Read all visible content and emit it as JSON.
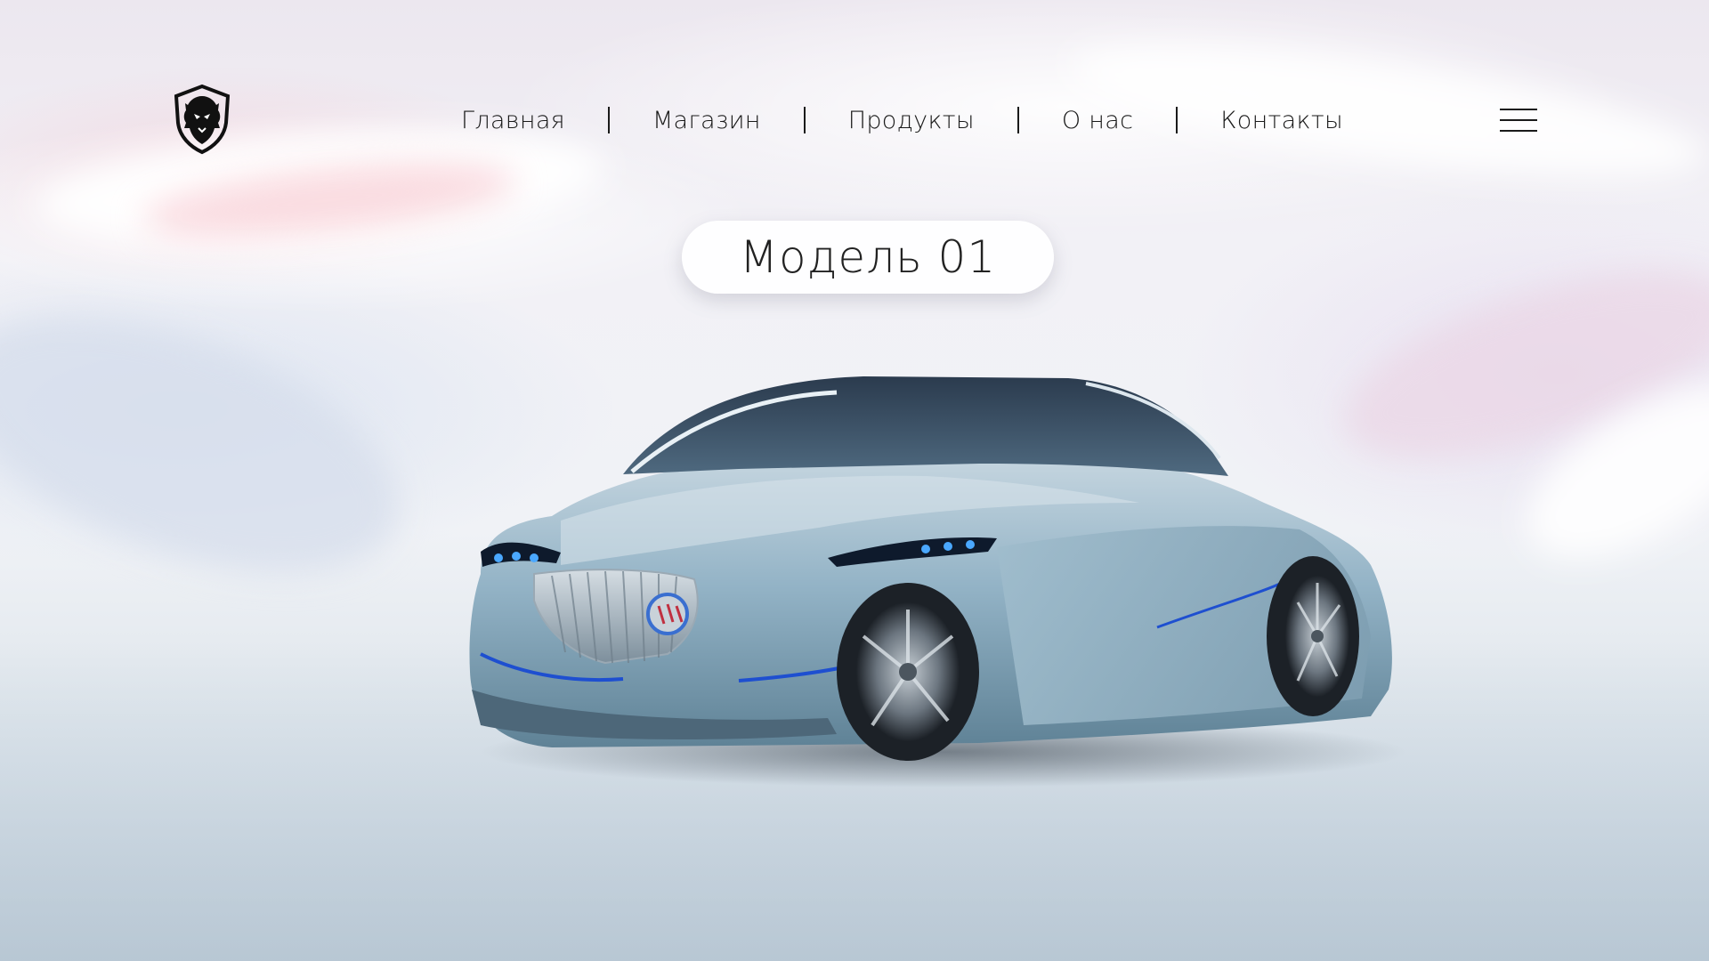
{
  "header": {
    "logo_icon": "lion-shield-logo-icon",
    "nav": [
      {
        "label": "Главная"
      },
      {
        "label": "Магазин"
      },
      {
        "label": "Продукты"
      },
      {
        "label": "О нас"
      },
      {
        "label": "Контакты"
      }
    ],
    "menu_icon": "hamburger-menu-icon"
  },
  "hero": {
    "title": "Модель 01",
    "image": "silver-blue-concept-car"
  },
  "colors": {
    "text": "#1a1a1a",
    "car_body": "#8fb0c4",
    "headlight": "#2a8cff"
  }
}
